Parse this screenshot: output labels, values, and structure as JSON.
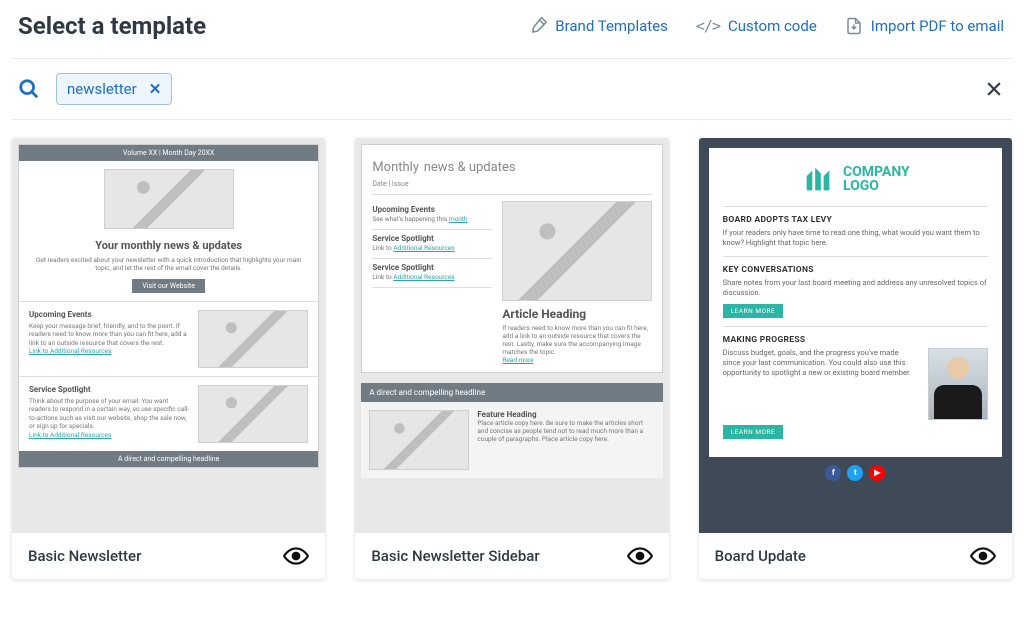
{
  "header": {
    "title": "Select a template",
    "links": {
      "brand_templates": "Brand Templates",
      "custom_code": "Custom code",
      "import_pdf": "Import PDF to email"
    }
  },
  "search": {
    "chip_value": "newsletter"
  },
  "templates": [
    {
      "name": "Basic Newsletter"
    },
    {
      "name": "Basic Newsletter Sidebar"
    },
    {
      "name": "Board Update"
    }
  ],
  "thumb1": {
    "topbar": "Volume XX | Month Day 20XX",
    "h1": "Your monthly news & updates",
    "intro": "Get readers excited about your newsletter with a quick introduction that highlights your main topic, and let the rest of the email cover the details.",
    "cta": "Visit our Website",
    "sec1_title": "Upcoming Events",
    "sec1_body": "Keep your message brief, friendly, and to the point. If readers need to know more than you can fit here, add a link to an outside resource that covers the rest.",
    "sec2_title": "Service Spotlight",
    "sec2_body": "Think about the purpose of your email: You want readers to respond in a certain way, so use specific call-to-actions such as visit our website, shop the sale now, or sign up for specials.",
    "link": "Link to Additional Resources",
    "bottombar": "A direct and compelling headline"
  },
  "thumb2": {
    "h1a": "Monthly",
    "h1b": "news & updates",
    "date": "Date | Issue",
    "side1_t": "Upcoming Events",
    "side1_p": "See what's happening this ",
    "side1_l": "month",
    "side2_t": "Service Spotlight",
    "side2_p": "Link to ",
    "side2_l": "Additional Resources",
    "side3_t": "Service Spotlight",
    "side3_p": "Link to ",
    "side3_l": "Additional Resources",
    "article_h": "Article Heading",
    "article_p": "If readers need to know more than you can fit here, add a link to an outside resource that covers the rest. Lastly, make sure the accompanying image matches the topic.",
    "readmore": "Read more",
    "bar": "A direct and compelling headline",
    "feat_h": "Feature Heading",
    "feat_p": "Place article copy here. Be sure to make the articles short and concise as people tend not to read much more than a couple of paragraphs. Place article copy here."
  },
  "thumb3": {
    "logo_a": "COMPANY",
    "logo_b": "LOGO",
    "s1_t": "BOARD ADOPTS TAX LEVY",
    "s1_p": "If your readers only have time to read one thing, what would you want them to know? Highlight that topic here.",
    "s2_t": "KEY CONVERSATIONS",
    "s2_p": "Share notes from your last board meeting and address any unresolved topics of discussion.",
    "s3_t": "MAKING PROGRESS",
    "s3_p": "Discuss budget, goals, and the progress you've made since your last communication. You could also use this opportunity to spotlight a new or existing board member.",
    "btn": "LEARN MORE"
  }
}
